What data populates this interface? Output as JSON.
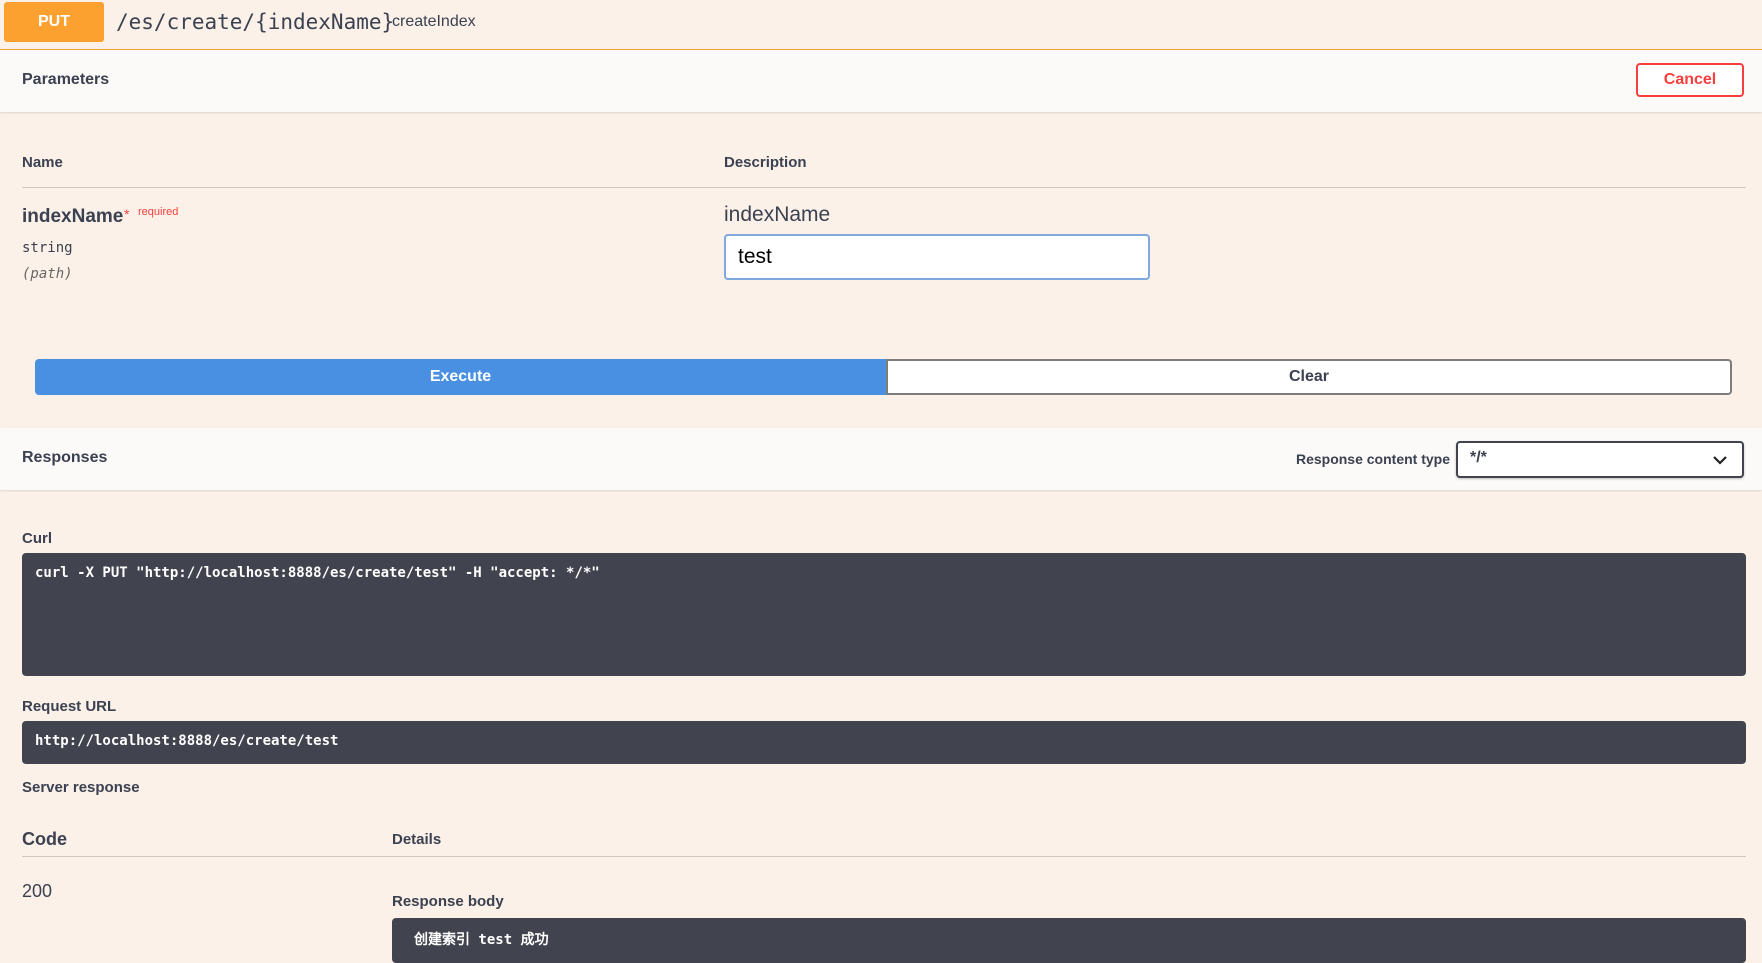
{
  "operation": {
    "method": "PUT",
    "path": "/es/create/{indexName}",
    "summary": "createIndex",
    "method_color": "#fca130"
  },
  "parameters": {
    "title": "Parameters",
    "cancel_label": "Cancel",
    "col_name": "Name",
    "col_description": "Description",
    "items": [
      {
        "name": "indexName",
        "required_star": "*",
        "required_label": "required",
        "type": "string",
        "in": "(path)",
        "description": "indexName",
        "value": "test"
      }
    ]
  },
  "actions": {
    "execute_label": "Execute",
    "clear_label": "Clear",
    "execute_color": "#4990e2"
  },
  "responses": {
    "title": "Responses",
    "content_type_label": "Response content type",
    "content_type_value": "*/*",
    "curl_label": "Curl",
    "curl_command": "curl -X PUT \"http://localhost:8888/es/create/test\" -H \"accept: */*\"",
    "request_url_label": "Request URL",
    "request_url": "http://localhost:8888/es/create/test",
    "server_response_label": "Server response",
    "code_header": "Code",
    "details_header": "Details",
    "code_value": "200",
    "response_body_label": "Response body",
    "response_body": "创建索引 test 成功"
  },
  "colors": {
    "background": "#fbf1e8",
    "cancel": "#f93e3e",
    "code_bg": "#41444e"
  }
}
